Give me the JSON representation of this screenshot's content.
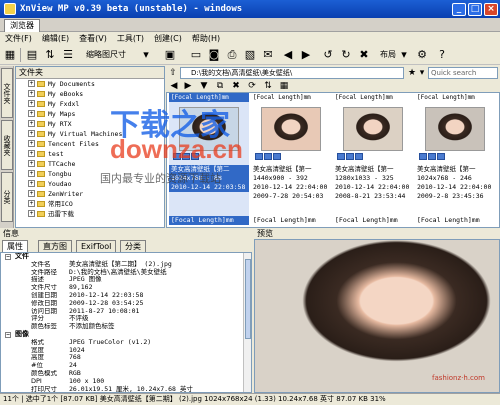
{
  "window": {
    "title": "XnView MP v0.39 beta (unstable) - windows"
  },
  "tabs": {
    "browser": "浏览器"
  },
  "menu": [
    "文件(F)",
    "编辑(E)",
    "查看(V)",
    "工具(T)",
    "创建(C)",
    "帮助(H)"
  ],
  "toolbar": {
    "thumb_size_label": "缩略图尺寸",
    "layout_label": "布局"
  },
  "left_tabs": [
    "文件夹",
    "收藏夹",
    "分类"
  ],
  "folders": {
    "header": "文件夹",
    "items": [
      "My Documents",
      "My eBooks",
      "My Fxdxl",
      "My Maps",
      "My RTX",
      "My Virtual Machines",
      "Tencent Files",
      "test",
      "TTCache",
      "Tongbu",
      "Youdao",
      "ZenWriter",
      "常用ICO",
      "迅雷下载"
    ]
  },
  "path": {
    "value": "D:\\我的文档\\高清壁纸\\美女壁纸\\",
    "search_placeholder": "Quick search"
  },
  "thumbnails": [
    {
      "cap1": "[Focal Length]mm",
      "name": "美女高清壁纸【第二",
      "res": "1024x768 - 88",
      "date1": "2010-12-14 22:03:58",
      "date2": "",
      "cap2": "[Focal Length]mm",
      "selected": true
    },
    {
      "cap1": "[Focal Length]mm",
      "name": "美女高清壁纸【第一",
      "res": "1440x900 - 392",
      "date1": "2010-12-14 22:04:00",
      "date2": "2009-7-28 20:54:03",
      "cap2": "[Focal Length]mm",
      "selected": false
    },
    {
      "cap1": "[Focal Length]mm",
      "name": "美女高清壁纸【第一",
      "res": "1280x1033 - 325",
      "date1": "2010-12-14 22:04:00",
      "date2": "2008-8-21 23:53:44",
      "cap2": "[Focal Length]mm",
      "selected": false
    },
    {
      "cap1": "[Focal Length]mm",
      "name": "美女高清壁纸【第一",
      "res": "1024x768 - 246",
      "date1": "2010-12-14 22:04:00",
      "date2": "2009-2-8 23:45:36",
      "cap2": "[Focal Length]mm",
      "selected": false
    }
  ],
  "info": {
    "section_label": "信息",
    "tabs": [
      "属性",
      "直方图",
      "ExifTool",
      "分类"
    ],
    "groups": [
      {
        "title": "文件",
        "rows": [
          {
            "k": "文件名",
            "v": "美女高清壁纸【第二期】 (2).jpg"
          },
          {
            "k": "文件路径",
            "v": "D:\\我的文档\\高清壁纸\\美女壁纸"
          },
          {
            "k": "描述",
            "v": "JPEG 图像"
          },
          {
            "k": "文件尺寸",
            "v": "89,162"
          },
          {
            "k": "创建日期",
            "v": "2010-12-14 22:03:58"
          },
          {
            "k": "修改日期",
            "v": "2009-12-28 03:54:25"
          },
          {
            "k": "访问日期",
            "v": "2011-8-27 10:08:01"
          },
          {
            "k": "评分",
            "v": "不评级"
          },
          {
            "k": "颜色标签",
            "v": "不添加颜色标签"
          }
        ]
      },
      {
        "title": "图像",
        "rows": [
          {
            "k": "格式",
            "v": "JPEG TrueColor (v1.2)"
          },
          {
            "k": "宽度",
            "v": "1024"
          },
          {
            "k": "高度",
            "v": "768"
          },
          {
            "k": "#位",
            "v": "24"
          },
          {
            "k": "颜色模式",
            "v": "RGB"
          },
          {
            "k": "DPI",
            "v": "100 x 100"
          },
          {
            "k": "打印尺寸",
            "v": "26.01x19.51 厘米, 10.24x7.68 英寸"
          }
        ]
      }
    ]
  },
  "preview": {
    "header": "预览",
    "caption": "fashionz·h.com"
  },
  "status": {
    "text": "11个 | 选中了1个 [87.07 KB] 美女高清壁纸【第二期】 (2).jpg 1024x768x24 (1.33) 10.24x7.68 英寸 87.07 KB 31%"
  },
  "watermark": {
    "logo": "下载之家",
    "url": "downza.cn",
    "slogan": "国内最专业的资源下载站"
  },
  "colors": {
    "titlebar": "#0a3fb0",
    "selection": "#3169c6",
    "accent": "#f3d24a"
  }
}
